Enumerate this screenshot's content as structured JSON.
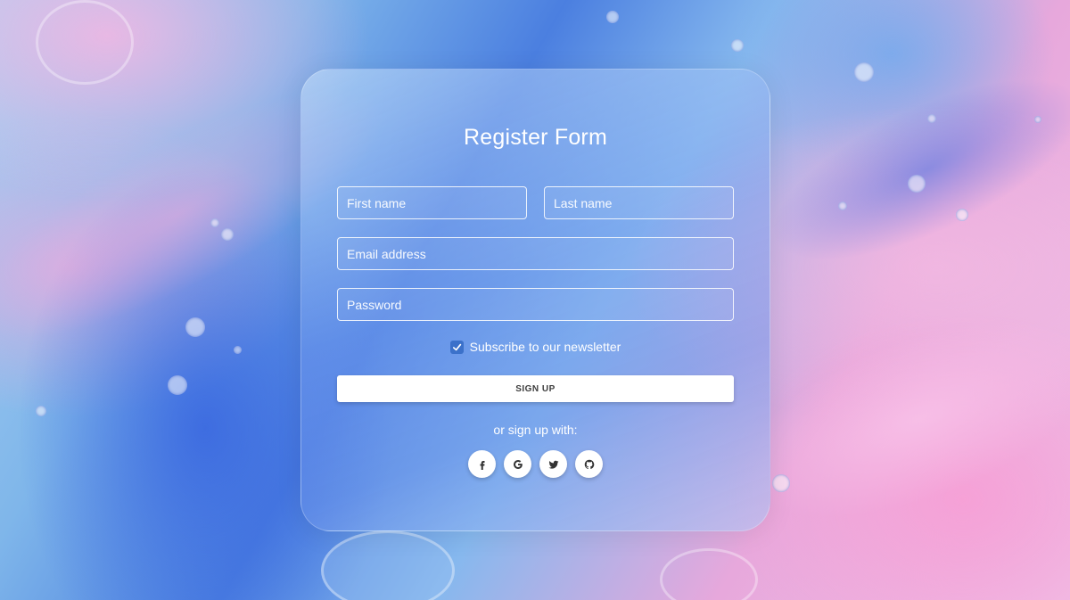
{
  "form": {
    "title": "Register Form",
    "first_name_placeholder": "First name",
    "last_name_placeholder": "Last name",
    "email_placeholder": "Email address",
    "password_placeholder": "Password",
    "newsletter_label": "Subscribe to our newsletter",
    "newsletter_checked": true,
    "signup_label": "SIGN UP",
    "alt_signup_text": "or sign up with:"
  },
  "social_buttons": [
    {
      "icon": "facebook-icon"
    },
    {
      "icon": "google-icon"
    },
    {
      "icon": "twitter-icon"
    },
    {
      "icon": "github-icon"
    }
  ],
  "colors": {
    "checkbox": "#3b71ca",
    "button_bg": "#ffffff",
    "text": "#ffffff"
  }
}
